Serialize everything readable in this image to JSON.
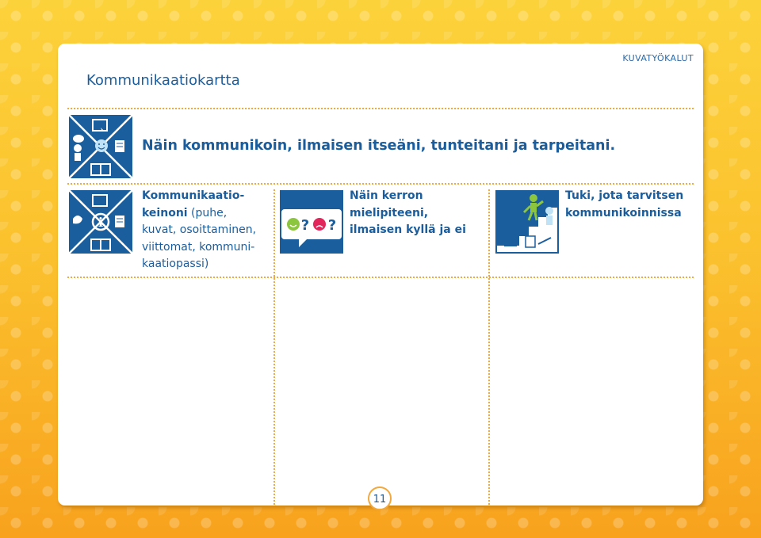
{
  "header": {
    "section_tag": "KUVATYÖKALUT",
    "title": "Kommunikaatiokartta"
  },
  "main": {
    "heading": "Näin kommunikoin, ilmaisen itseäni, tunteitani ja tarpeitani."
  },
  "columns": [
    {
      "bold_lines": [
        "Kommunikaatio-",
        "keinoni"
      ],
      "rest_inline": " (puhe,",
      "lines": [
        "kuvat, osoittaminen,",
        "viittomat, kommuni-",
        "kaatiopassi)"
      ]
    },
    {
      "lines": [
        "Näin kerron",
        "mielipiteeni,",
        "ilmaisen kyllä ja ei"
      ]
    },
    {
      "lines": [
        "Tuki, jota tarvitsen",
        "kommunikoinnissa"
      ]
    }
  ],
  "footer": {
    "page_number": "11"
  },
  "icons": {
    "main": "communication-map-icon",
    "col1": "communication-methods-icon",
    "col2": "opinion-yes-no-icon",
    "col3": "support-stairs-icon"
  },
  "colors": {
    "accent_blue": "#1b5e9e",
    "dotted_orange": "#f3a83b",
    "smiley_green": "#8cc63f",
    "smiley_red": "#e2265b"
  }
}
